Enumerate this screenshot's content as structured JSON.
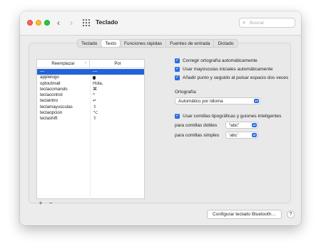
{
  "window": {
    "title": "Teclado"
  },
  "search": {
    "placeholder": "Buscar"
  },
  "tabs": [
    {
      "label": "Teclado",
      "active": false
    },
    {
      "label": "Texto",
      "active": true
    },
    {
      "label": "Funciones rápidas",
      "active": false
    },
    {
      "label": "Fuentes de entrada",
      "active": false
    },
    {
      "label": "Dictado",
      "active": false
    }
  ],
  "table": {
    "headers": {
      "replace": "Reemplazar",
      "with": "Por"
    },
    "rows": [
      {
        "replace": "—",
        "with": "—",
        "selected": true
      },
      {
        "replace": "applelogo",
        "with": "",
        "selected": false
      },
      {
        "replace": "optoutmail",
        "with": "Hola,",
        "selected": false
      },
      {
        "replace": "teclacomando",
        "with": "⌘",
        "selected": false
      },
      {
        "replace": "teclacontrol",
        "with": "^",
        "selected": false
      },
      {
        "replace": "teclaintro",
        "with": "↵",
        "selected": false
      },
      {
        "replace": "teclamayusculas",
        "with": "⇧",
        "selected": false
      },
      {
        "replace": "teclaopcion",
        "with": "⌥",
        "selected": false
      },
      {
        "replace": "teclashift",
        "with": "⇧",
        "selected": false
      }
    ],
    "add_label": "+",
    "remove_label": "−"
  },
  "options": {
    "autocorrect": "Corregir ortografía automáticamente",
    "autocapitalize": "Usar mayúsculas iniciales automáticamente",
    "period": "Añadir punto y seguido al pulsar espacio dos veces",
    "spelling_label": "Ortografía:",
    "spelling_value": "Automático por idioma",
    "smart_quotes": "Usar comillas tipográficas y guiones inteligentes",
    "double_label": "para comillas dobles",
    "double_value": "“abc”",
    "single_label": "para comillas simples",
    "single_value": "‘abc’"
  },
  "buttons": {
    "bluetooth": "Configurar teclado Bluetooth…",
    "help": "?"
  },
  "colors": {
    "accent": "#2a6ee6",
    "selection": "#2463d6"
  }
}
